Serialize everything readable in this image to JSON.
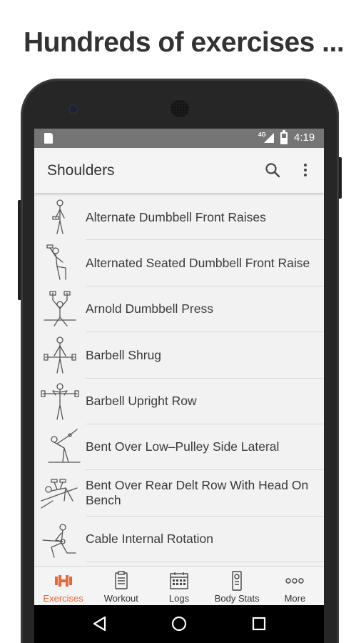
{
  "headline": "Hundreds of exercises ...",
  "status_bar": {
    "network": "4G",
    "time": "4:19"
  },
  "toolbar": {
    "title": "Shoulders",
    "search_icon": "search-icon",
    "menu_icon": "more-vert-icon"
  },
  "exercises": [
    {
      "name": "Alternate Dumbbell Front Raises",
      "icon": "exercise-figure-icon"
    },
    {
      "name": "Alternated Seated Dumbbell Front Raise",
      "icon": "exercise-figure-icon"
    },
    {
      "name": "Arnold Dumbbell Press",
      "icon": "exercise-figure-icon"
    },
    {
      "name": "Barbell Shrug",
      "icon": "exercise-figure-icon"
    },
    {
      "name": "Barbell Upright Row",
      "icon": "exercise-figure-icon"
    },
    {
      "name": "Bent Over Low–Pulley Side Lateral",
      "icon": "exercise-figure-icon"
    },
    {
      "name": "Bent Over Rear Delt Row With Head On Bench",
      "icon": "exercise-figure-icon"
    },
    {
      "name": "Cable Internal Rotation",
      "icon": "exercise-figure-icon"
    }
  ],
  "bottom_nav": [
    {
      "label": "Exercises",
      "icon": "dumbbell-icon",
      "active": true
    },
    {
      "label": "Workout",
      "icon": "clipboard-icon",
      "active": false
    },
    {
      "label": "Logs",
      "icon": "calendar-icon",
      "active": false
    },
    {
      "label": "Body Stats",
      "icon": "scale-icon",
      "active": false
    },
    {
      "label": "More",
      "icon": "more-dots-icon",
      "active": false
    }
  ],
  "colors": {
    "accent": "#e8683a",
    "status_bar": "#757575",
    "screen_bg": "#f2f2f2",
    "text": "#3a3a3a"
  }
}
